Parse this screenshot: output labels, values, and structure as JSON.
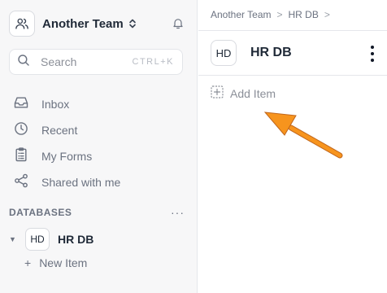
{
  "sidebar": {
    "team": {
      "name": "Another Team",
      "icon": "users-icon",
      "switch_icon": "chevron-updown-icon",
      "bell_icon": "bell-icon"
    },
    "search": {
      "placeholder": "Search",
      "shortcut": "CTRL+K",
      "icon": "search-icon"
    },
    "nav": [
      {
        "label": "Inbox",
        "icon": "inbox-icon"
      },
      {
        "label": "Recent",
        "icon": "clock-icon"
      },
      {
        "label": "My Forms",
        "icon": "clipboard-icon"
      },
      {
        "label": "Shared with me",
        "icon": "share-icon"
      }
    ],
    "databases": {
      "title": "DATABASES",
      "more": "···",
      "items": [
        {
          "badge": "HD",
          "name": "HR DB",
          "expanded": true
        }
      ],
      "new_item": {
        "plus": "+",
        "label": "New Item"
      }
    }
  },
  "main": {
    "breadcrumb": [
      "Another Team",
      "HR DB"
    ],
    "breadcrumb_sep": ">",
    "header": {
      "badge": "HD",
      "title": "HR DB"
    },
    "add_item": {
      "label": "Add Item",
      "icon": "add-square-icon"
    }
  },
  "colors": {
    "arrow": "#f7941d",
    "sidebar_bg": "#f7f7f8",
    "border": "#e5e7eb",
    "muted_text": "#6b7280"
  }
}
